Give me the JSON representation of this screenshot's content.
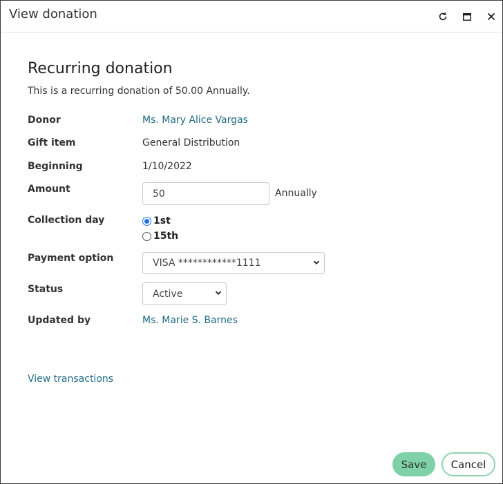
{
  "window": {
    "title": "View donation",
    "controls": {
      "refresh_icon": "refresh-icon",
      "maximize_icon": "maximize-icon",
      "close_icon": "close-icon"
    }
  },
  "content": {
    "heading": "Recurring donation",
    "summary": "This is a recurring donation of 50.00 Annually.",
    "fields": {
      "donor": {
        "label": "Donor",
        "value": "Ms. Mary Alice Vargas"
      },
      "gift_item": {
        "label": "Gift item",
        "value": "General Distribution"
      },
      "beginning": {
        "label": "Beginning",
        "value": "1/10/2022"
      },
      "amount": {
        "label": "Amount",
        "value": "50",
        "suffix": "Annually"
      },
      "collection_day": {
        "label": "Collection day",
        "options": [
          "1st",
          "15th"
        ],
        "selected": "1st"
      },
      "payment_option": {
        "label": "Payment option",
        "value": "VISA ************1111"
      },
      "status": {
        "label": "Status",
        "value": "Active"
      },
      "updated_by": {
        "label": "Updated by",
        "value": "Ms. Marie S. Barnes"
      }
    },
    "view_transactions": "View transactions"
  },
  "footer": {
    "save_label": "Save",
    "cancel_label": "Cancel"
  },
  "colors": {
    "link": "#1f6b86",
    "save_bg": "#7fd2a7",
    "cancel_border": "#8fd2b0",
    "radio_accent": "#1a73e8"
  }
}
